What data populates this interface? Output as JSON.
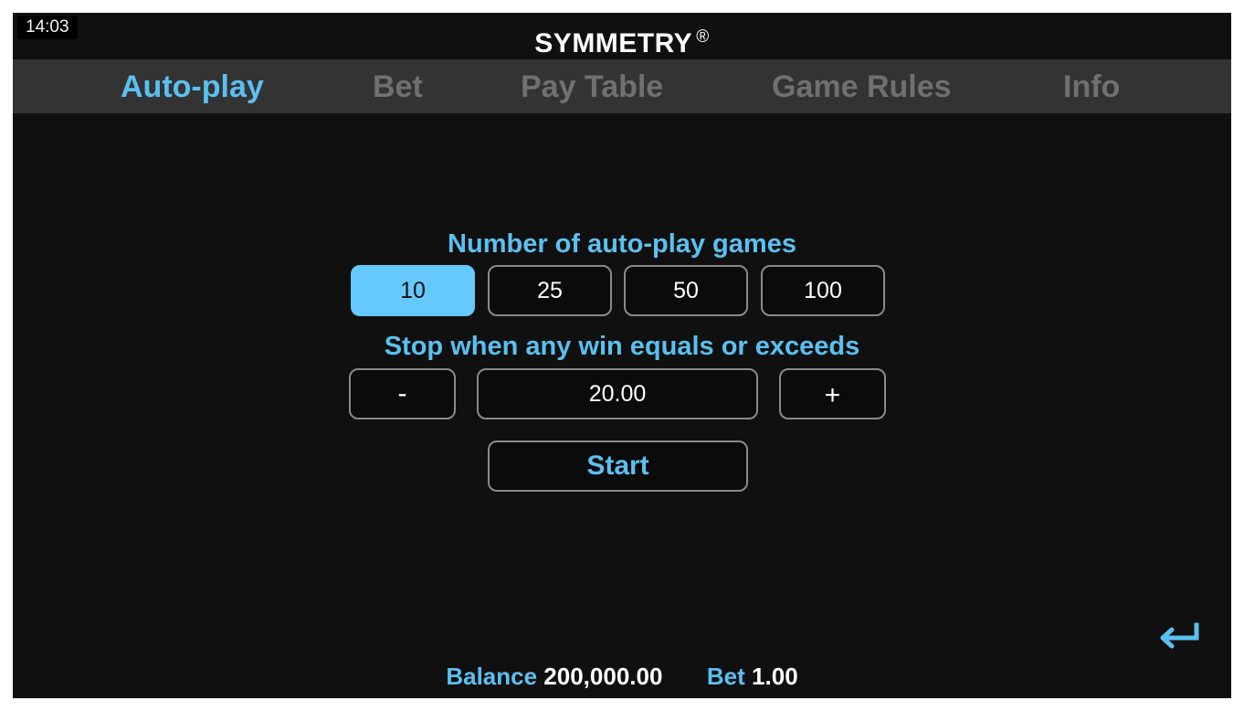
{
  "status": {
    "time": "14:03"
  },
  "header": {
    "title": "SYMMETRY",
    "registered_mark": "®"
  },
  "tabs": [
    {
      "label": "Auto-play",
      "active": true
    },
    {
      "label": "Bet",
      "active": false
    },
    {
      "label": "Pay Table",
      "active": false
    },
    {
      "label": "Game Rules",
      "active": false
    },
    {
      "label": "Info",
      "active": false
    }
  ],
  "autoplay": {
    "games_heading": "Number of auto-play games",
    "game_options": [
      "10",
      "25",
      "50",
      "100"
    ],
    "selected_games": "10",
    "stop_heading": "Stop when any win equals or exceeds",
    "decrease_label": "-",
    "stop_value": "20.00",
    "increase_label": "+",
    "start_label": "Start"
  },
  "footer": {
    "balance_label": "Balance",
    "balance_value": "200,000.00",
    "bet_label": "Bet",
    "bet_value": "1.00"
  },
  "icons": {
    "return": "return-arrow-icon"
  },
  "colors": {
    "accent": "#5bc0f0",
    "selected": "#66c9fb",
    "tab_inactive": "#707070",
    "background": "#101010"
  }
}
